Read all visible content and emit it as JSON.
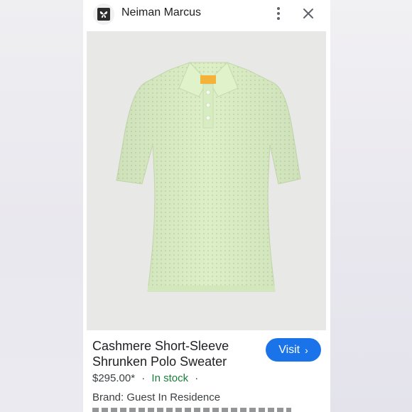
{
  "header": {
    "site_name": "Neiman Marcus",
    "site_icon": "butterfly-logo-icon",
    "more_icon": "more-vert-icon",
    "close_icon": "close-icon"
  },
  "product": {
    "image_subject": "polo-sweater-image",
    "title_line1": "Cashmere Short-Sleeve",
    "title_line2": "Shrunken Polo Sweater",
    "price": "$295.00*",
    "separator": "·",
    "stock_status": "In stock",
    "brand_label": "Brand: Guest In Residence"
  },
  "actions": {
    "visit_label": "Visit",
    "visit_chevron": "›"
  },
  "colors": {
    "accent_blue": "#1a73e8",
    "stock_green": "#188038",
    "sweater_green": "#dcefc6"
  }
}
